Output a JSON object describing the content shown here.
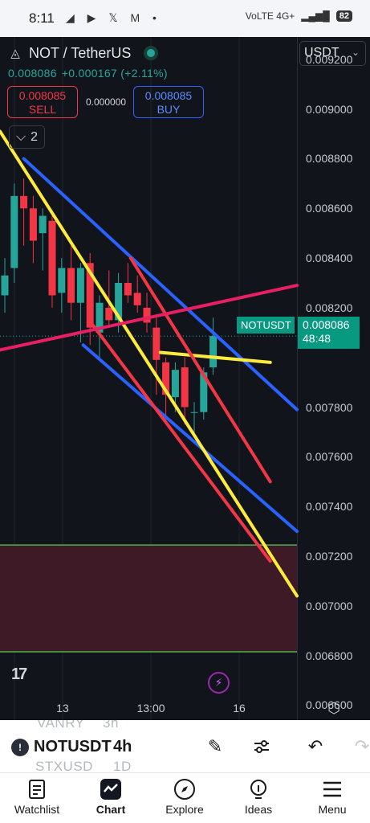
{
  "status_bar": {
    "time": "8:11",
    "app_icons": "◢ ▶ 𝕏 M •",
    "network": "VoLTE 4G+",
    "battery": "82"
  },
  "chart_header": {
    "symbol": "NOT / TetherUS",
    "last_price": "0.008086",
    "change": "+0.000167 (+2.11%)",
    "sell_price": "0.008085",
    "sell_label": "SELL",
    "buy_price": "0.008085",
    "buy_label": "BUY",
    "spread": "0.000000",
    "collapse_count": "2",
    "currency": "USDT"
  },
  "price_tag": {
    "symbol": "NOTUSDT",
    "price": "0.008086",
    "countdown": "48:48"
  },
  "colors": {
    "up": "#26a69a",
    "down": "#f23645",
    "blue_line": "#2962ff",
    "yellow_line": "#ffeb3b",
    "pink_line": "#e91e63",
    "zone_fill": "#3d1a26",
    "zone_border": "#4caf50"
  },
  "chart_data": {
    "type": "candlestick",
    "y_ticks": [
      "0.009200",
      "0.009000",
      "0.008800",
      "0.008600",
      "0.008400",
      "0.008200",
      "0.007800",
      "0.007600",
      "0.007400",
      "0.007200",
      "0.007000",
      "0.006800",
      "0.006600"
    ],
    "x_ticks": [
      "13",
      "13:00",
      "16"
    ],
    "ylim": [
      0.00654,
      0.00929
    ],
    "last_price": 0.008086,
    "candles": [
      {
        "o": 0.00825,
        "h": 0.0084,
        "l": 0.00818,
        "c": 0.00833
      },
      {
        "o": 0.00836,
        "h": 0.0087,
        "l": 0.0083,
        "c": 0.00865
      },
      {
        "o": 0.00865,
        "h": 0.00872,
        "l": 0.00845,
        "c": 0.0086
      },
      {
        "o": 0.0086,
        "h": 0.00865,
        "l": 0.00838,
        "c": 0.00847
      },
      {
        "o": 0.0085,
        "h": 0.0086,
        "l": 0.00835,
        "c": 0.00857
      },
      {
        "o": 0.00855,
        "h": 0.00858,
        "l": 0.0082,
        "c": 0.00825
      },
      {
        "o": 0.00826,
        "h": 0.0084,
        "l": 0.00818,
        "c": 0.00836
      },
      {
        "o": 0.00836,
        "h": 0.00845,
        "l": 0.00815,
        "c": 0.00822
      },
      {
        "o": 0.00822,
        "h": 0.00838,
        "l": 0.00806,
        "c": 0.00836
      },
      {
        "o": 0.00838,
        "h": 0.00842,
        "l": 0.00805,
        "c": 0.00812
      },
      {
        "o": 0.0081,
        "h": 0.00825,
        "l": 0.008,
        "c": 0.00822
      },
      {
        "o": 0.0082,
        "h": 0.00835,
        "l": 0.00812,
        "c": 0.00815
      },
      {
        "o": 0.00815,
        "h": 0.00834,
        "l": 0.0081,
        "c": 0.0083
      },
      {
        "o": 0.0083,
        "h": 0.00838,
        "l": 0.00822,
        "c": 0.00825
      },
      {
        "o": 0.00826,
        "h": 0.00833,
        "l": 0.00818,
        "c": 0.00821
      },
      {
        "o": 0.0082,
        "h": 0.00826,
        "l": 0.0081,
        "c": 0.00814
      },
      {
        "o": 0.00812,
        "h": 0.00816,
        "l": 0.00785,
        "c": 0.00799
      },
      {
        "o": 0.00798,
        "h": 0.008,
        "l": 0.00775,
        "c": 0.00785
      },
      {
        "o": 0.00784,
        "h": 0.00798,
        "l": 0.00778,
        "c": 0.00795
      },
      {
        "o": 0.00796,
        "h": 0.008,
        "l": 0.00773,
        "c": 0.0078
      },
      {
        "o": 0.00778,
        "h": 0.00782,
        "l": 0.00768,
        "c": 0.00778
      },
      {
        "o": 0.00778,
        "h": 0.00796,
        "l": 0.00775,
        "c": 0.00794
      },
      {
        "o": 0.00796,
        "h": 0.00816,
        "l": 0.00793,
        "c": 0.008086
      }
    ],
    "drawings": [
      {
        "name": "blue-trendline-upper",
        "color": "#2962ff",
        "points": [
          [
            0.08,
            0.0088
          ],
          [
            1.0,
            0.00779
          ]
        ]
      },
      {
        "name": "blue-trendline-lower",
        "color": "#2962ff",
        "points": [
          [
            0.28,
            0.00805
          ],
          [
            1.0,
            0.0073
          ]
        ]
      },
      {
        "name": "yellow-trendline-long",
        "color": "#ffeb3b",
        "points": [
          [
            0.0,
            0.00891
          ],
          [
            1.0,
            0.00704
          ]
        ]
      },
      {
        "name": "yellow-trendline-short",
        "color": "#ffeb3b",
        "points": [
          [
            0.54,
            0.00802
          ],
          [
            0.91,
            0.00798
          ]
        ]
      },
      {
        "name": "red-trendline-upper",
        "color": "#f23645",
        "points": [
          [
            0.44,
            0.0084
          ],
          [
            0.91,
            0.0075
          ]
        ]
      },
      {
        "name": "red-trendline-lower",
        "color": "#f23645",
        "points": [
          [
            0.3,
            0.00815
          ],
          [
            0.91,
            0.00718
          ]
        ]
      },
      {
        "name": "pink-trendline",
        "color": "#e91e63",
        "points": [
          [
            0.0,
            0.00803
          ],
          [
            1.0,
            0.00829
          ]
        ]
      }
    ],
    "zone": {
      "top": 0.007245,
      "bottom": 0.006815
    }
  },
  "toolbar": {
    "symbol": "NOTUSDT",
    "interval": "4h",
    "ghost_above_symbol": "VANRY",
    "ghost_above_interval": "3h",
    "ghost_below_symbol": "STXUSD",
    "ghost_below_interval": "1D"
  },
  "bottom_nav": [
    {
      "label": "Watchlist"
    },
    {
      "label": "Chart"
    },
    {
      "label": "Explore"
    },
    {
      "label": "Ideas"
    },
    {
      "label": "Menu"
    }
  ]
}
